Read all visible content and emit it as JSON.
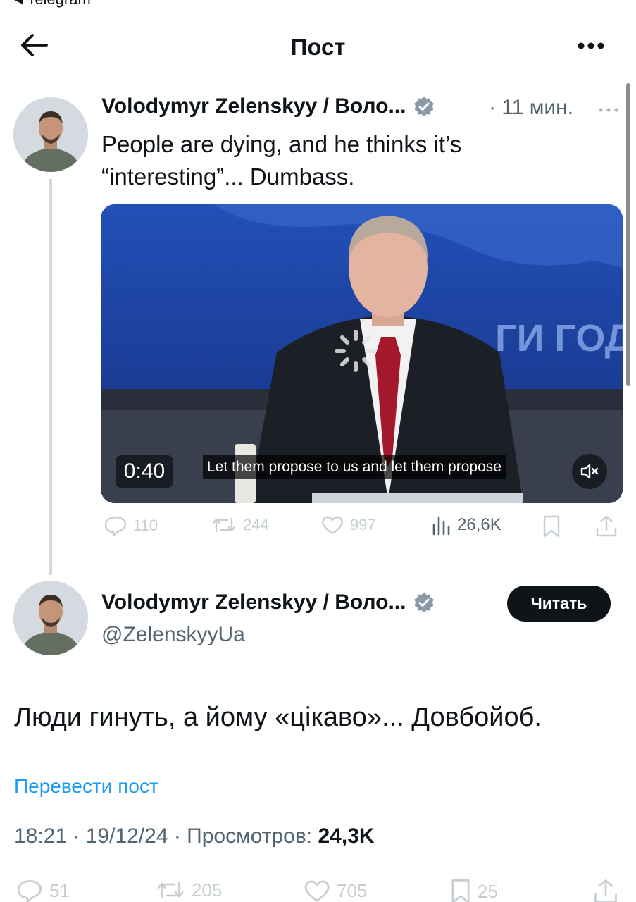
{
  "status": {
    "back_app": "Telegram"
  },
  "header": {
    "title": "Пост"
  },
  "thread_tweet": {
    "author_name": "Volodymyr Zelenskyy / Воло...",
    "time": "· 11 мин.",
    "text_line1": "People are dying, and he thinks it’s",
    "text_line2": "“interesting”... Dumbass.",
    "video": {
      "duration": "0:40",
      "subtitle": "Let them propose to us and let them propose",
      "backdrop_text": "ГИ ГОД"
    },
    "actions": {
      "replies": "110",
      "reposts": "244",
      "likes": "997",
      "views": "26,6K"
    }
  },
  "main_tweet": {
    "author_name": "Volodymyr Zelenskyy / Воло...",
    "handle": "@ZelenskyyUa",
    "follow_label": "Читать",
    "text": "Люди гинуть, а йому «цікаво»... Довбойоб.",
    "translate_label": "Перевести пост",
    "meta_time": "18:21 · 19/12/24 · Просмотров:",
    "meta_views": "24,3K",
    "actions": {
      "replies": "51",
      "reposts": "205",
      "likes": "705",
      "bookmarks": "25"
    }
  },
  "colors": {
    "link": "#1d9bf0",
    "verified": "#8b98a5",
    "text": "#0f1419",
    "muted": "#536471"
  }
}
